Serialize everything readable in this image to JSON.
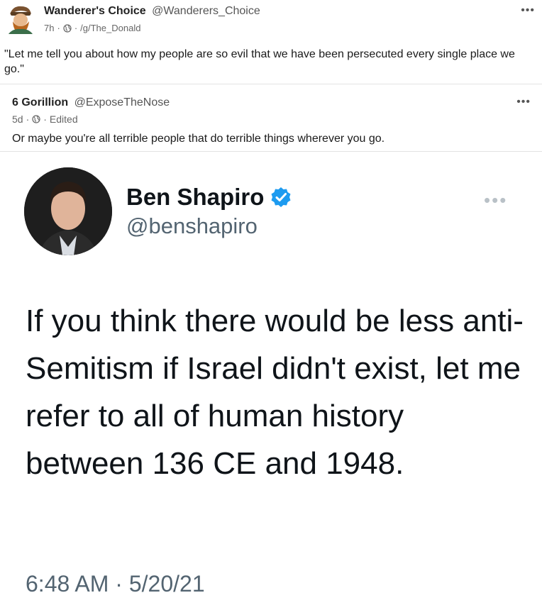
{
  "post": {
    "author_name": "Wanderer's Choice",
    "author_handle": "@Wanderers_Choice",
    "time": "7h",
    "separator": "·",
    "community": "/g/The_Donald",
    "more": "•••",
    "body": "\"Let me tell you about how my people are so evil that we have been persecuted every single place we go.\""
  },
  "quote": {
    "author_name": "6 Gorillion",
    "author_handle": "@ExposeTheNose",
    "time": "5d",
    "edited": "Edited",
    "more": "•••",
    "body": "Or maybe you're all terrible people that do terrible things wherever you go."
  },
  "tweet": {
    "name": "Ben Shapiro",
    "handle": "@benshapiro",
    "more": "•••",
    "text": "If you think there would be less anti-Semitism if Israel didn't exist, let me refer to all of human history between 136 CE and 1948.",
    "timestamp": "6:48 AM · 5/20/21",
    "verified_color": "#1d9bf0"
  },
  "icons": {
    "post_visibility": "globe-icon",
    "quote_visibility": "globe-icon",
    "verified": "verified-badge-icon"
  }
}
